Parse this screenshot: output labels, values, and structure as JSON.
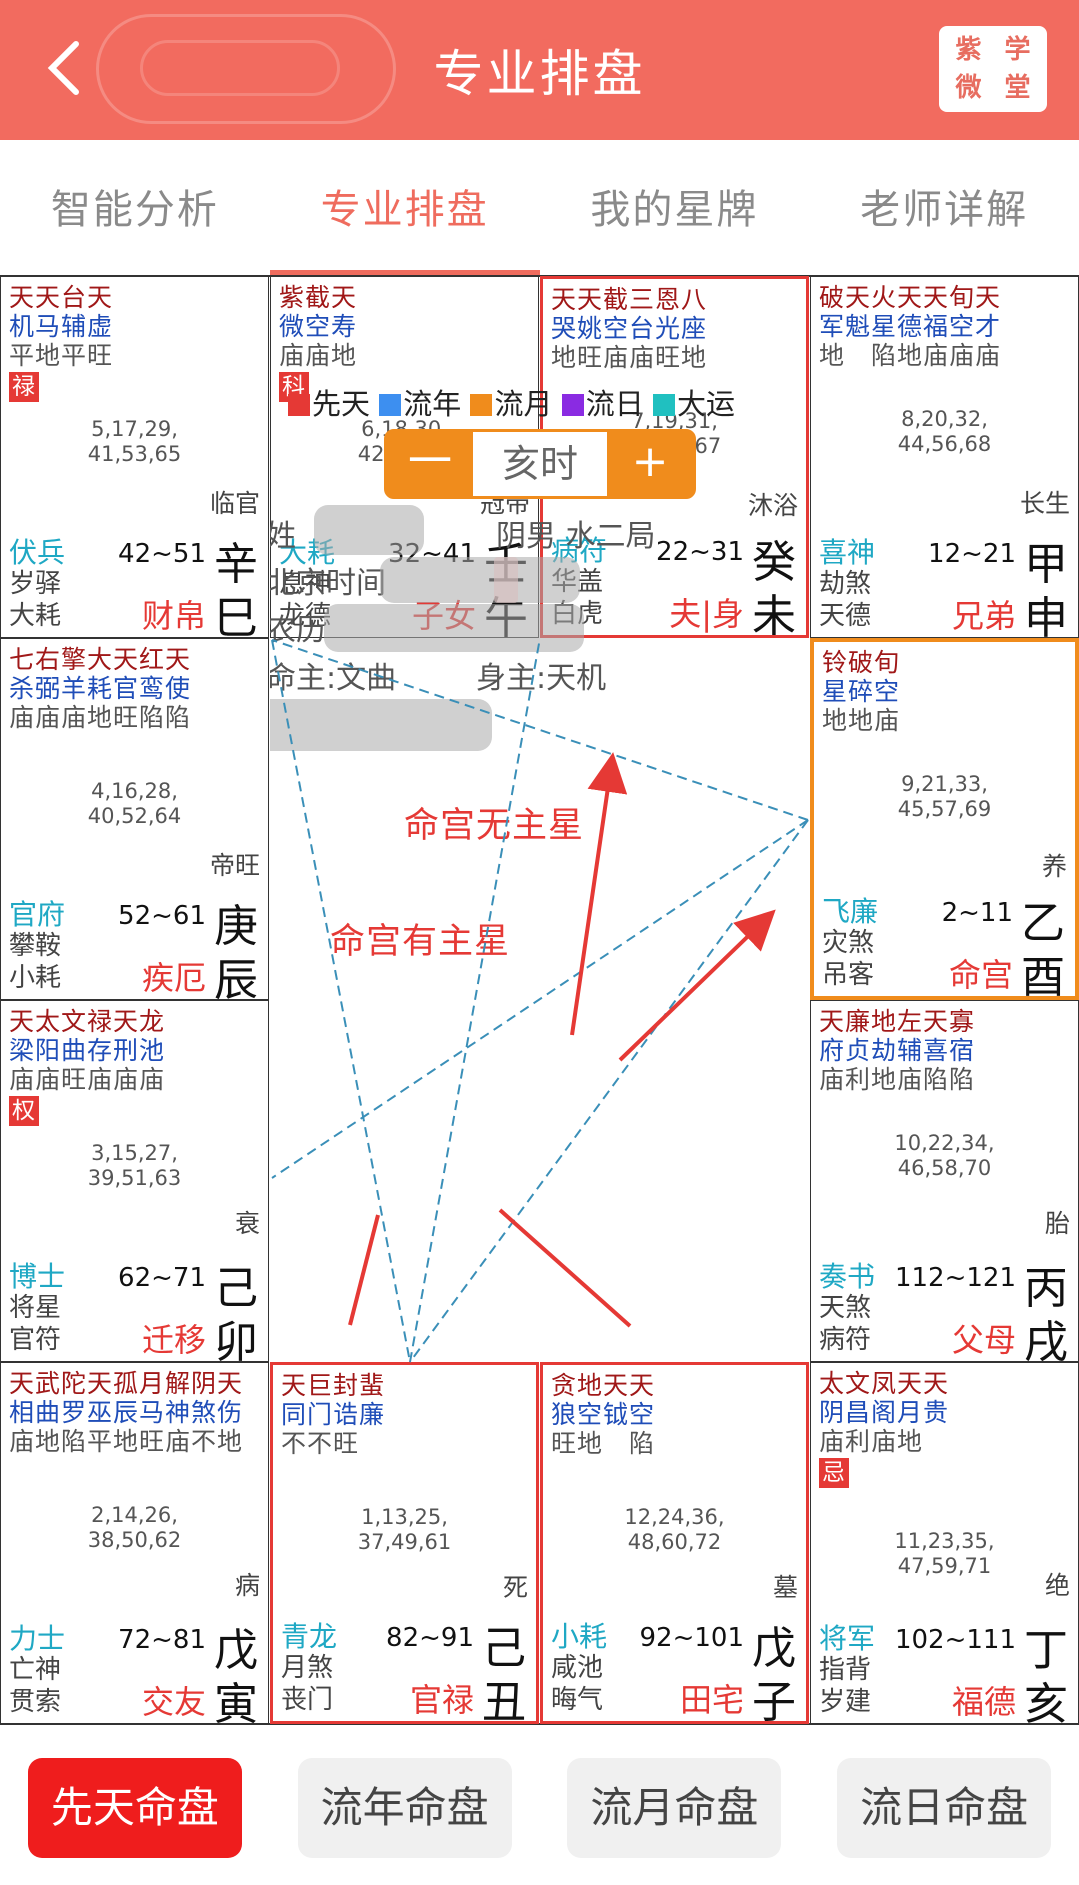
{
  "header": {
    "title": "专业排盘",
    "logo": [
      "紫",
      "学",
      "微",
      "堂"
    ]
  },
  "tabs": [
    {
      "label": "智能分析"
    },
    {
      "label": "专业排盘"
    },
    {
      "label": "我的星牌"
    },
    {
      "label": "老师详解"
    }
  ],
  "cells": [
    {
      "stars_row1": "天天台天",
      "stars_row2": "机马辅虚",
      "bright": "平地平旺",
      "badge": "禄",
      "ages": [
        "5,17,29,",
        "41,53,65"
      ],
      "stage": "临官",
      "god1": "伏兵",
      "god2": "岁驿",
      "god3": "大耗",
      "range": "42~51",
      "palace": "财帛",
      "stem": "辛",
      "branch": "巳"
    },
    {
      "stars_row1": "紫截天",
      "stars_row2": "微空寿",
      "bright": "庙庙地",
      "badge": "科",
      "ages": [
        "6,18,30,",
        "42,54,66"
      ],
      "stage": "冠带",
      "god1": "大耗",
      "god2": "息神",
      "god3": "龙德",
      "range": "32~41",
      "palace": "子女",
      "stem": "壬",
      "branch": "午"
    },
    {
      "stars_row1": "天天截三恩八",
      "stars_row2": "哭姚空台光座",
      "bright": "地旺庙庙旺地",
      "badge": "",
      "ages": [
        "7,19,31,",
        "43,55,67"
      ],
      "stage": "沐浴",
      "god1": "病符",
      "god2": "华盖",
      "god3": "白虎",
      "range": "22~31",
      "palace": "夫|身",
      "stem": "癸",
      "branch": "未"
    },
    {
      "stars_row1": "破天火天天旬天",
      "stars_row2": "军魁星德福空才",
      "bright": "地　陷地庙庙庙",
      "badge": "",
      "ages": [
        "8,20,32,",
        "44,56,68"
      ],
      "stage": "长生",
      "god1": "喜神",
      "god2": "劫煞",
      "god3": "天德",
      "range": "12~21",
      "palace": "兄弟",
      "stem": "甲",
      "branch": "申"
    },
    {
      "stars_row1": "铃破旬",
      "stars_row2": "星碎空",
      "bright": "地地庙",
      "badge": "",
      "ages": [
        "9,21,33,",
        "45,57,69"
      ],
      "stage": "养",
      "god1": "飞廉",
      "god2": "灾煞",
      "god3": "吊客",
      "range": "2~11",
      "palace": "命宫",
      "stem": "乙",
      "branch": "酉"
    },
    {
      "stars_row1": "天廉地左天寡",
      "stars_row2": "府贞劫辅喜宿",
      "bright": "庙利地庙陷陷",
      "badge": "",
      "ages": [
        "10,22,34,",
        "46,58,70"
      ],
      "stage": "胎",
      "god1": "奏书",
      "god2": "天煞",
      "god3": "病符",
      "range": "112~121",
      "palace": "父母",
      "stem": "丙",
      "branch": "戌"
    },
    {
      "stars_row1": "太文凤天天",
      "stars_row2": "阴昌阁月贵",
      "bright": "庙利庙地",
      "badge": "忌",
      "ages": [
        "11,23,35,",
        "47,59,71"
      ],
      "stage": "绝",
      "god1": "将军",
      "god2": "指背",
      "god3": "岁建",
      "range": "102~111",
      "palace": "福德",
      "stem": "丁",
      "branch": "亥"
    },
    {
      "stars_row1": "贪地天天",
      "stars_row2": "狼空钺空",
      "bright": "旺地　陷",
      "badge": "",
      "ages": [
        "12,24,36,",
        "48,60,72"
      ],
      "stage": "墓",
      "god1": "小耗",
      "god2": "咸池",
      "god3": "晦气",
      "range": "92~101",
      "palace": "田宅",
      "stem": "戊",
      "branch": "子"
    },
    {
      "stars_row1": "天巨封蜚",
      "stars_row2": "同门诰廉",
      "bright": "不不旺",
      "badge": "",
      "ages": [
        "1,13,25,",
        "37,49,61"
      ],
      "stage": "死",
      "god1": "青龙",
      "god2": "月煞",
      "god3": "丧门",
      "range": "82~91",
      "palace": "官禄",
      "stem": "己",
      "branch": "丑"
    },
    {
      "stars_row1": "天武陀天孤月解阴天",
      "stars_row2": "相曲罗巫辰马神煞伤",
      "bright": "庙地陷平地旺庙不地",
      "badge": "",
      "ages": [
        "2,14,26,",
        "38,50,62"
      ],
      "stage": "病",
      "god1": "力士",
      "god2": "亡神",
      "god3": "贯索",
      "range": "72~81",
      "palace": "交友",
      "stem": "戊",
      "branch": "寅"
    },
    {
      "stars_row1": "天太文禄天龙",
      "stars_row2": "梁阳曲存刑池",
      "bright": "庙庙旺庙庙庙",
      "badge": "权",
      "ages": [
        "3,15,27,",
        "39,51,63"
      ],
      "stage": "衰",
      "god1": "博士",
      "god2": "将星",
      "god3": "官符",
      "range": "62~71",
      "palace": "迁移",
      "stem": "己",
      "branch": "卯"
    },
    {
      "stars_row1": "七右擎大天红天",
      "stars_row2": "杀弼羊耗官鸾使",
      "bright": "庙庙庙地旺陷陷",
      "badge": "",
      "ages": [
        "4,16,28,",
        "40,52,64"
      ],
      "stage": "帝旺",
      "god1": "官府",
      "god2": "攀鞍",
      "god3": "小耗",
      "range": "52~61",
      "palace": "疾厄",
      "stem": "庚",
      "branch": "辰"
    }
  ],
  "center": {
    "legend": [
      {
        "label": "先天",
        "color": "#e53935"
      },
      {
        "label": "流年",
        "color": "#3d8ff0"
      },
      {
        "label": "流月",
        "color": "#f08c1c"
      },
      {
        "label": "流日",
        "color": "#8a2be2"
      },
      {
        "label": "大运",
        "color": "#20c0c0"
      }
    ],
    "hour": "亥时",
    "minus": "一",
    "plus": "+",
    "name_label": "姓",
    "gender_bureau": "阴男 水二局",
    "beijing_time": "北京时间",
    "lunar": "农历",
    "ming_zhu": "命主:文曲",
    "shen_zhu": "身主:天机",
    "annotation_none": "命宫无主星",
    "annotation_has": "命宫有主星"
  },
  "bottom_buttons": [
    {
      "label": "先天命盘"
    },
    {
      "label": "流年命盘"
    },
    {
      "label": "流月命盘"
    },
    {
      "label": "流日命盘"
    }
  ],
  "colors": {
    "header": "#f26b5f",
    "accent": "#ef6c5e",
    "red": "#e53935",
    "orange": "#f08c1c",
    "cyan_god": "#1fa8c4",
    "star_red": "#a01818",
    "star_blue": "#1f4db8"
  }
}
